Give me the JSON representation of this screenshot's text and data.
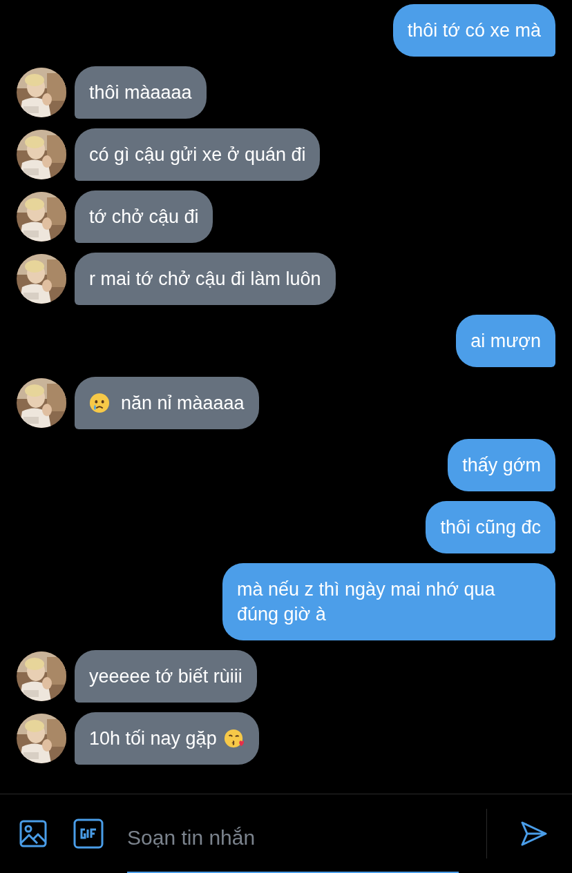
{
  "messages": [
    {
      "kind": "outgoing",
      "text": "thôi tớ có xe mà"
    },
    {
      "kind": "incoming",
      "text": "thôi màaaaa"
    },
    {
      "kind": "incoming",
      "text": "có gì cậu gửi xe ở quán đi"
    },
    {
      "kind": "incoming",
      "text": "tớ chở cậu đi"
    },
    {
      "kind": "incoming",
      "text": "r mai tớ chở cậu đi làm luôn"
    },
    {
      "kind": "outgoing",
      "text": "ai mượn"
    },
    {
      "kind": "incoming",
      "text": "năn nỉ màaaaa",
      "lead_icon": {
        "kind": "crying"
      }
    },
    {
      "kind": "outgoing",
      "text": "thấy gớm"
    },
    {
      "kind": "outgoing",
      "text": "thôi cũng đc"
    },
    {
      "kind": "outgoing",
      "text": "mà nếu z thì ngày mai nhớ qua đúng giờ à"
    },
    {
      "kind": "incoming",
      "text": "yeeeee tớ biết rùiii"
    },
    {
      "kind": "incoming",
      "text": "10h tối nay gặp",
      "trail_icon": {
        "kind": "kiss"
      }
    }
  ],
  "composer": {
    "placeholder": "Soạn tin nhắn"
  }
}
